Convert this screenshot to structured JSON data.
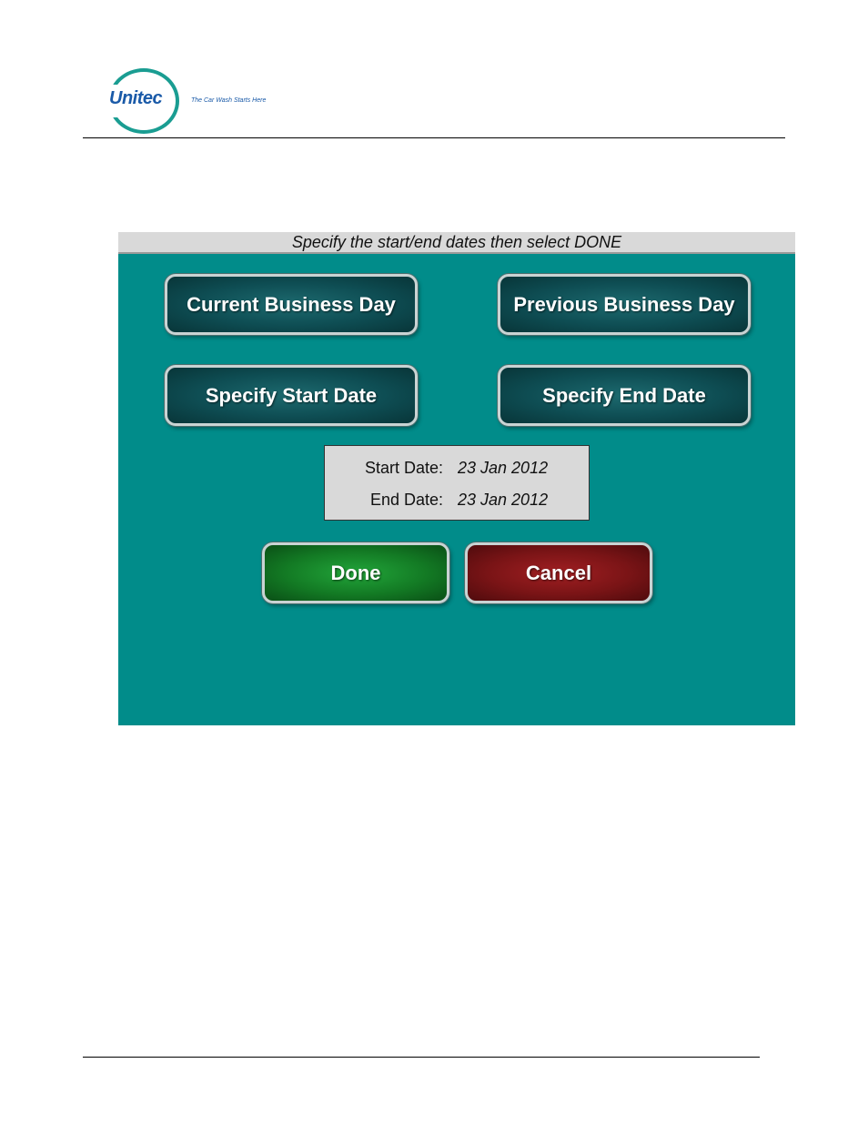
{
  "logo": {
    "brand": "Unitec",
    "tagline": "The Car Wash Starts Here"
  },
  "screen": {
    "title": "Specify the start/end dates then select DONE",
    "buttons": {
      "current_business_day": "Current Business Day",
      "previous_business_day": "Previous Business Day",
      "specify_start_date": "Specify Start Date",
      "specify_end_date": "Specify End Date",
      "done": "Done",
      "cancel": "Cancel"
    },
    "dates": {
      "start_label": "Start Date:",
      "start_value": "23 Jan 2012",
      "end_label": "End Date:",
      "end_value": "23 Jan 2012"
    }
  },
  "colors": {
    "screen_bg": "#018c8a",
    "titlebar_bg": "#d9d9d9",
    "button_teal": "#0e4d53",
    "button_done": "#137a24",
    "button_cancel": "#7a1416",
    "brand_blue": "#1a5aa8",
    "brand_ring": "#1a9d92"
  }
}
